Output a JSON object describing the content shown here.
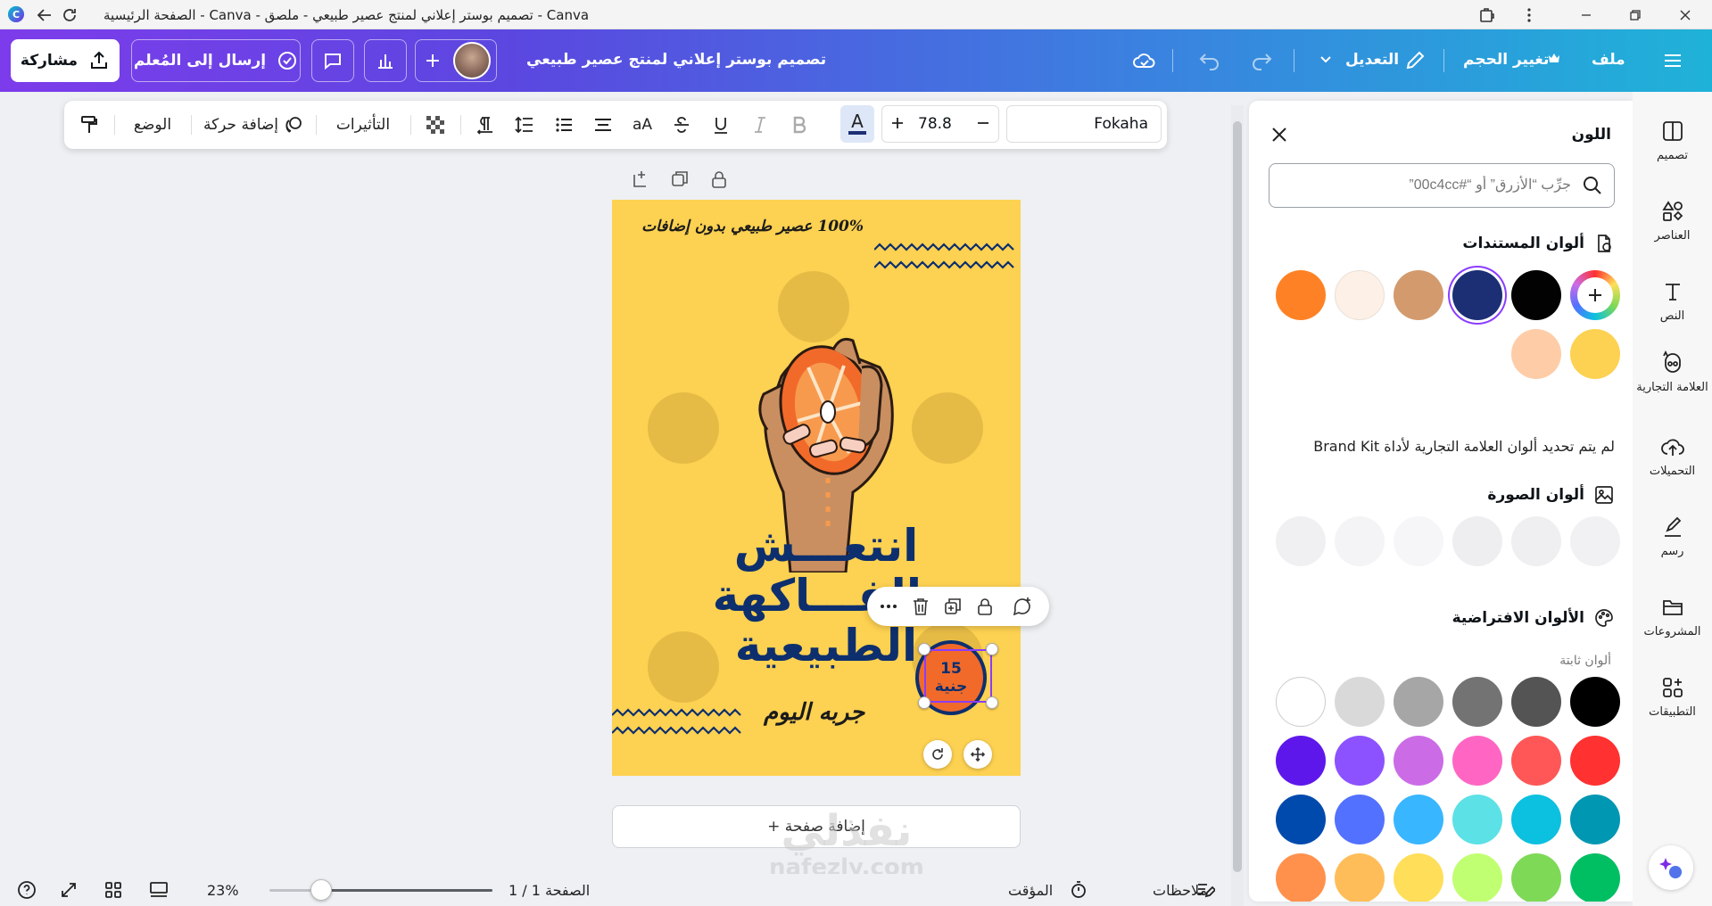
{
  "titlebar": {
    "title": "الصفحة الرئيسية - Canva - تصميم بوستر إعلاني لمنتج عصير طبيعي - ملصق - Canva"
  },
  "topbar": {
    "share_label": "مشاركة",
    "send_label": "إرسال إلى المُعلم",
    "doc_title": "تصميم بوستر إعلاني لمنتج عصير طبيعي",
    "edit_label": "التعديل",
    "resize_label": "تغيير الحجم",
    "file_label": "ملف"
  },
  "text_toolbar": {
    "font_name": "Fokaha",
    "font_size": "78.8",
    "position_label": "الوضع",
    "animate_label": "إضافة حركة",
    "effects_label": "التأثيرات",
    "case_label": "aA"
  },
  "poster": {
    "top_text": "100% عصير طبيعي بدون إضافات",
    "headline_lines": [
      "انتعـــش",
      "بالفـــاكهة",
      "الطبيعية"
    ],
    "try_today": "جربه اليوم",
    "price_line1": "15",
    "price_line2": "جنية",
    "bg_color": "#fdd151",
    "headline_color": "#0d2f6e",
    "orange_color": "#f16a2a"
  },
  "canvas": {
    "add_page_label": "+ إضافة صفحة",
    "watermark_ar": "نفذلي",
    "watermark_en": "nafezly.com"
  },
  "bottombar": {
    "notes_label": "ملاحظات",
    "timer_label": "المؤقت",
    "page_label": "الصفحة 1 / 1",
    "zoom_label": "23%",
    "zoom_fraction": 0.23
  },
  "color_panel": {
    "title": "اللون",
    "search_placeholder": "جرِّب “الأزرق” أو “#00c4cc”",
    "doc_colors_heading": "ألوان المستندات",
    "doc_colors": [
      "#fe8225",
      "#fdf0e6",
      "#d39b6d",
      "#1c2f75",
      "#020202",
      "#fdd151",
      "#fecda8"
    ],
    "brand_note": "لم يتم تحديد ألوان العلامة التجارية لأداة Brand Kit",
    "image_colors_heading": "ألوان الصورة",
    "image_colors": [
      "#f1f1f3",
      "#efeff1",
      "#eeeef0",
      "#f6f6f8",
      "#f4f4f6",
      "#f0f0f2"
    ],
    "default_colors_heading": "الألوان الافتراضية",
    "fixed_colors_label": "ألوان ثابتة",
    "default_colors": [
      [
        "#000000",
        "#545454",
        "#737373",
        "#a6a6a6",
        "#d9d9d9",
        "#ffffff"
      ],
      [
        "#ff3131",
        "#ff5757",
        "#ff66c4",
        "#cb6ce6",
        "#8c52ff",
        "#5e17eb"
      ],
      [
        "#0097b2",
        "#0cc0df",
        "#5ce1e6",
        "#38b6ff",
        "#5271ff",
        "#004aad"
      ],
      [
        "#00bf63",
        "#7ed957",
        "#c1ff72",
        "#ffde59",
        "#ffbd59",
        "#ff914d"
      ]
    ]
  },
  "rail": {
    "items": [
      "تصميم",
      "العناصر",
      "النص",
      "العلامة التجارية",
      "التحميلات",
      "رسم",
      "المشروعات",
      "التطبيقات"
    ]
  }
}
